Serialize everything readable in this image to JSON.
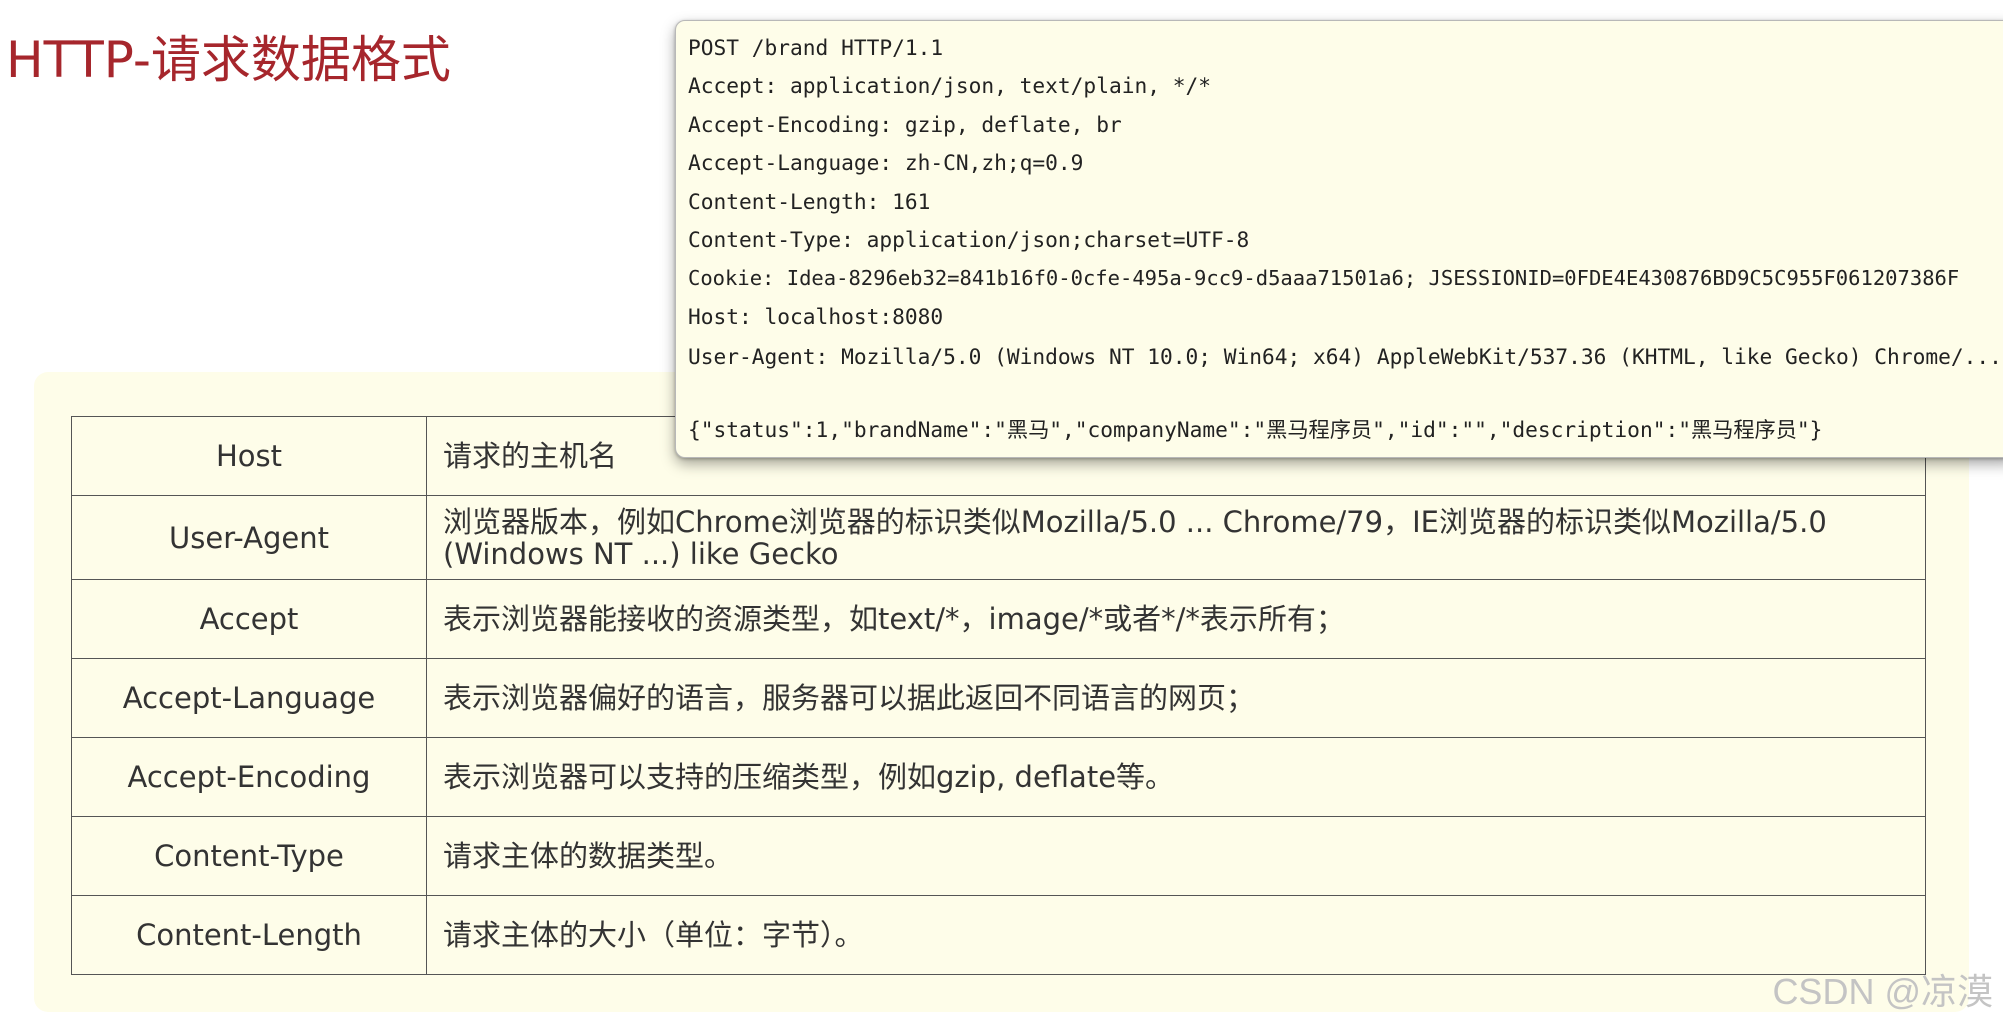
{
  "page": {
    "title": "HTTP-请求数据格式"
  },
  "request": {
    "lines": [
      "POST /brand HTTP/1.1",
      "Accept: application/json, text/plain, */*",
      "Accept-Encoding: gzip, deflate, br",
      "Accept-Language: zh-CN,zh;q=0.9",
      "Content-Length: 161",
      "Content-Type: application/json;charset=UTF-8",
      "Cookie: Idea-8296eb32=841b16f0-0cfe-495a-9cc9-d5aaa71501a6; JSESSIONID=0FDE4E430876BD9C5C955F061207386F",
      "Host: localhost:8080",
      "User-Agent: Mozilla/5.0 (Windows NT 10.0; Win64; x64) AppleWebKit/537.36 (KHTML, like Gecko) Chrome/..."
    ],
    "body": "{\"status\":1,\"brandName\":\"黑马\",\"companyName\":\"黑马程序员\",\"id\":\"\",\"description\":\"黑马程序员\"}"
  },
  "table": {
    "rows": [
      {
        "name": "Host",
        "description": "请求的主机名"
      },
      {
        "name": "User-Agent",
        "description": "浏览器版本，例如Chrome浏览器的标识类似Mozilla/5.0 ... Chrome/79，IE浏览器的标识类似Mozilla/5.0 (Windows NT ...) like Gecko"
      },
      {
        "name": "Accept",
        "description": "表示浏览器能接收的资源类型，如text/*，image/*或者*/*表示所有；"
      },
      {
        "name": "Accept-Language",
        "description": "表示浏览器偏好的语言，服务器可以据此返回不同语言的网页；"
      },
      {
        "name": "Accept-Encoding",
        "description": "表示浏览器可以支持的压缩类型，例如gzip, deflate等。"
      },
      {
        "name": "Content-Type",
        "description": "请求主体的数据类型。"
      },
      {
        "name": "Content-Length",
        "description": "请求主体的大小（单位：字节）。"
      }
    ]
  },
  "watermark": "CSDN @凉漠"
}
